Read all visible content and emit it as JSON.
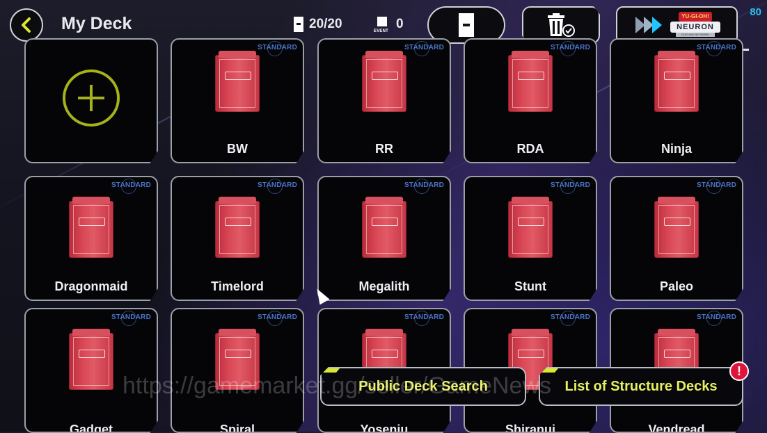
{
  "header": {
    "title": "My Deck",
    "deck_count": "20/20",
    "event_label": "EVENT",
    "event_count": "0",
    "neuron_logo_text_top": "YU-GI-OH!",
    "neuron_logo_text": "NEURON",
    "neuron_logo_text_bottom": "DUELING NETWORK",
    "corner_number": "80"
  },
  "decks": [
    {
      "name": "",
      "type": "add"
    },
    {
      "name": "BW",
      "badge": "STANDARD"
    },
    {
      "name": "RR",
      "badge": "STANDARD"
    },
    {
      "name": "RDA",
      "badge": "STANDARD"
    },
    {
      "name": "Ninja",
      "badge": "STANDARD"
    },
    {
      "name": "Dragonmaid",
      "badge": "STANDARD"
    },
    {
      "name": "Timelord",
      "badge": "STANDARD"
    },
    {
      "name": "Megalith",
      "badge": "STANDARD"
    },
    {
      "name": "Stunt",
      "badge": "STANDARD"
    },
    {
      "name": "Paleo",
      "badge": "STANDARD"
    },
    {
      "name": "Gadget",
      "badge": "STANDARD"
    },
    {
      "name": "Spiral",
      "badge": "STANDARD"
    },
    {
      "name": "Yosenju",
      "badge": "STANDARD"
    },
    {
      "name": "Shiranui",
      "badge": "STANDARD"
    },
    {
      "name": "Vendread",
      "badge": "STANDARD"
    }
  ],
  "bottom": {
    "public_search_label": "Public Deck Search",
    "structure_decks_label": "List of Structure Decks",
    "alert_symbol": "!"
  },
  "watermark": "https://gamemarket.gg/seller/GameNews",
  "colors": {
    "accent_yellow": "#d8e833",
    "add_green": "#a6b21a",
    "deck_red": "#d84654",
    "badge_blue": "#4a74c8",
    "alert_red": "#e0143a",
    "neuron_cyan": "#20c4ff"
  }
}
